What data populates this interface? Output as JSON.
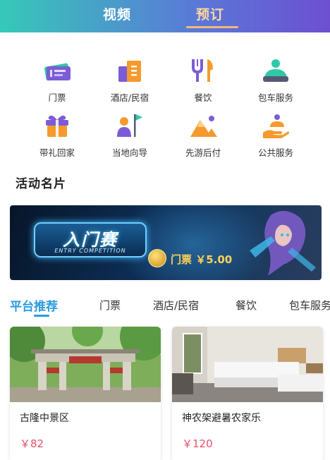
{
  "header": {
    "tabs": [
      {
        "label": "视频"
      },
      {
        "label": "预订"
      }
    ]
  },
  "categories": [
    {
      "label": "门票",
      "icon": "ticket-icon"
    },
    {
      "label": "酒店/民宿",
      "icon": "hotel-icon"
    },
    {
      "label": "餐饮",
      "icon": "dining-icon"
    },
    {
      "label": "包车服务",
      "icon": "car-icon"
    },
    {
      "label": "带礼回家",
      "icon": "gift-icon"
    },
    {
      "label": "当地向导",
      "icon": "guide-icon"
    },
    {
      "label": "先游后付",
      "icon": "mountain-icon"
    },
    {
      "label": "公共服务",
      "icon": "service-icon"
    }
  ],
  "section": {
    "title": "活动名片"
  },
  "banner": {
    "badge_title": "入门赛",
    "badge_subtitle": "ENTRY COMPETITION",
    "price": "门票 ￥5.00"
  },
  "filter_tabs": [
    {
      "label": "平台推荐"
    },
    {
      "label": "门票"
    },
    {
      "label": "酒店/民宿"
    },
    {
      "label": "餐饮"
    },
    {
      "label": "包车服务"
    }
  ],
  "cards": [
    {
      "title": "古隆中景区",
      "price": "￥82"
    },
    {
      "title": "神农架避暑农家乐",
      "price": "￥120"
    }
  ],
  "colors": {
    "accent": "#2a9be0",
    "price": "#e8506a",
    "header_start": "#36c9b7",
    "header_end": "#6d4fd0"
  }
}
